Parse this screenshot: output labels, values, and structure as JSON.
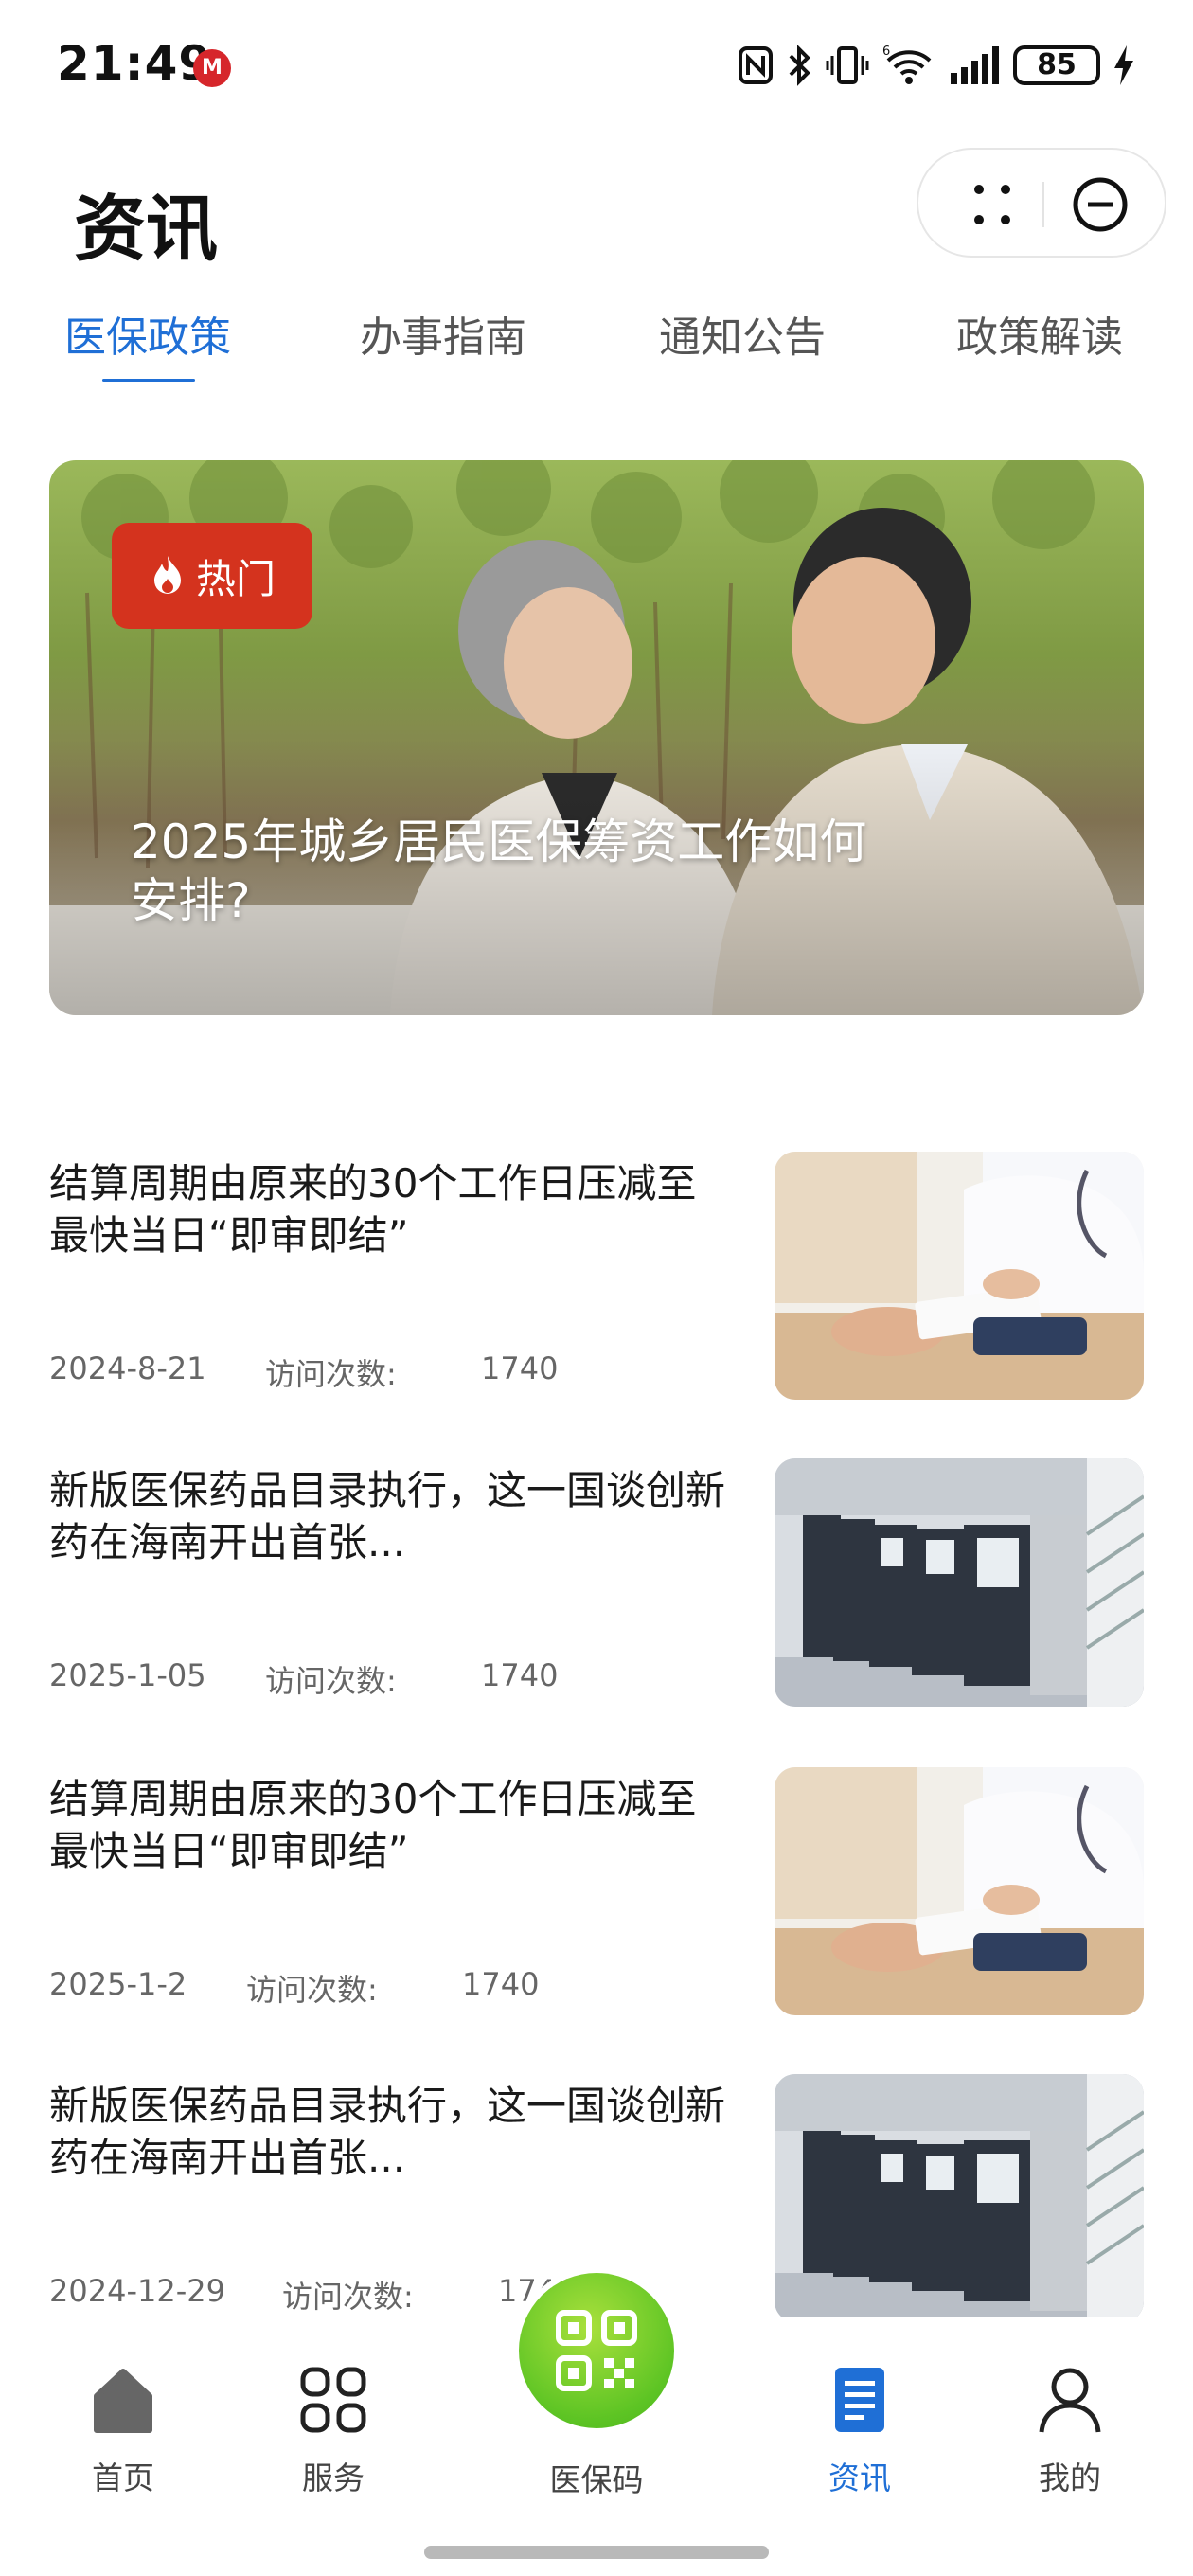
{
  "status_bar": {
    "time": "21:49",
    "carrier_badge": "M",
    "battery": "85"
  },
  "header": {
    "title": "资讯"
  },
  "tabs": [
    {
      "label": "医保政策",
      "active": true
    },
    {
      "label": "办事指南",
      "active": false
    },
    {
      "label": "通知公告",
      "active": false
    },
    {
      "label": "政策解读",
      "active": false
    }
  ],
  "banner": {
    "badge": "热门",
    "title": "2025年城乡居民医保筹资工作如何安排?"
  },
  "visits_label": "访问次数:",
  "news": [
    {
      "title": "结算周期由原来的30个工作日压减至最快当日“即审即结”",
      "date": "2024-8-21",
      "visits": "1740",
      "image": "doctor-consult"
    },
    {
      "title": "新版医保药品目录执行，这一国谈创新药在海南开出首张...",
      "date": "2025-1-05",
      "visits": "1740",
      "image": "self-service-kiosks"
    },
    {
      "title": "结算周期由原来的30个工作日压减至最快当日“即审即结”",
      "date": "2025-1-2",
      "visits": "1740",
      "image": "doctor-consult"
    },
    {
      "title": "新版医保药品目录执行，这一国谈创新药在海南开出首张...",
      "date": "2024-12-29",
      "visits": "1740",
      "image": "self-service-kiosks"
    }
  ],
  "bottom_nav": {
    "home": "首页",
    "services": "服务",
    "qr": "医保码",
    "news": "资讯",
    "mine": "我的"
  },
  "colors": {
    "accent": "#1f6fd6",
    "hot_badge": "#d4331e",
    "qr_green": "#5dc424"
  }
}
